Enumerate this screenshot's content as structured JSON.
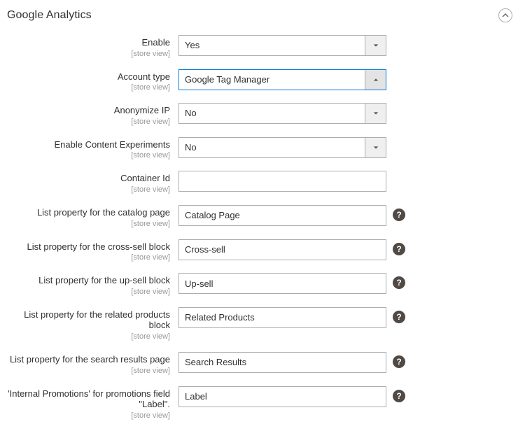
{
  "section": {
    "title": "Google Analytics"
  },
  "scope_label": "[store view]",
  "fields": {
    "enable": {
      "label": "Enable",
      "value": "Yes"
    },
    "account_type": {
      "label": "Account type",
      "value": "Google Tag Manager"
    },
    "anonymize": {
      "label": "Anonymize IP",
      "value": "No"
    },
    "experiments": {
      "label": "Enable Content Experiments",
      "value": "No"
    },
    "container": {
      "label": "Container Id",
      "value": ""
    },
    "catalog": {
      "label": "List property for the catalog page",
      "value": "Catalog Page"
    },
    "crosssell": {
      "label": "List property for the cross-sell block",
      "value": "Cross-sell"
    },
    "upsell": {
      "label": "List property for the up-sell block",
      "value": "Up-sell"
    },
    "related": {
      "label": "List property for the related products block",
      "value": "Related Products"
    },
    "search": {
      "label": "List property for the search results page",
      "value": "Search Results"
    },
    "promo": {
      "label": "'Internal Promotions' for promotions field \"Label\".",
      "value": "Label"
    }
  },
  "help_glyph": "?"
}
